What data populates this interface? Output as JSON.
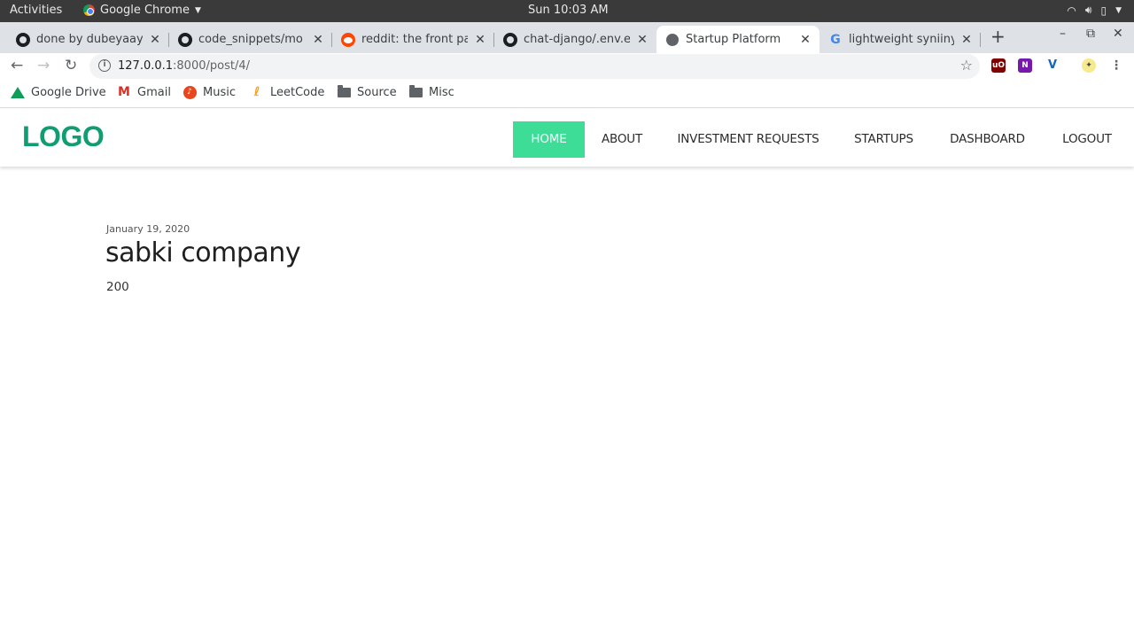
{
  "system_bar": {
    "activities": "Activities",
    "app_name": "Google Chrome",
    "clock": "Sun 10:03 AM"
  },
  "tabs": [
    {
      "title": "done by dubeyaayu",
      "icon": "github-icon"
    },
    {
      "title": "code_snippets/mo",
      "icon": "github-icon"
    },
    {
      "title": "reddit: the front pa",
      "icon": "reddit-icon"
    },
    {
      "title": "chat-django/.env.e",
      "icon": "github-icon"
    },
    {
      "title": "Startup Platform",
      "icon": "globe-icon",
      "active": true
    },
    {
      "title": "lightweight syniiny",
      "icon": "google-icon"
    }
  ],
  "address_bar": {
    "host": "127.0.0.1",
    "path": ":8000/post/4/"
  },
  "bookmarks": [
    {
      "label": "Google Drive",
      "icon": "google-drive-icon"
    },
    {
      "label": "Gmail",
      "icon": "gmail-icon"
    },
    {
      "label": "Music",
      "icon": "music-icon"
    },
    {
      "label": "LeetCode",
      "icon": "leetcode-icon"
    },
    {
      "label": "Source",
      "icon": "folder-icon"
    },
    {
      "label": "Misc",
      "icon": "folder-icon"
    }
  ],
  "site": {
    "logo": "LOGO",
    "nav": [
      {
        "label": "HOME",
        "active": true
      },
      {
        "label": "ABOUT"
      },
      {
        "label": "INVESTMENT REQUESTS"
      },
      {
        "label": "STARTUPS"
      },
      {
        "label": "DASHBOARD"
      },
      {
        "label": "LOGOUT"
      }
    ],
    "accent_color": "#3ddc97",
    "logo_color": "#0f9d71"
  },
  "post": {
    "date": "January 19, 2020",
    "title": "sabki company",
    "body": "200"
  }
}
